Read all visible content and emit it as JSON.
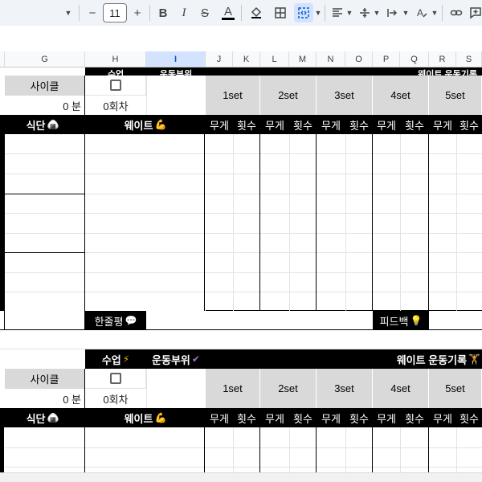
{
  "toolbar": {
    "font_size": "11",
    "minus": "−",
    "plus": "+",
    "bold": "B",
    "italic": "I",
    "strike": "S",
    "text_color": "A",
    "text_color_swatch": "#000000",
    "fill_icon": "paint-bucket-icon",
    "borders_icon": "borders-icon",
    "merge_icon": "merge-cells-icon",
    "align_icon": "align-left-icon",
    "valign_icon": "vertical-align-icon",
    "wrap_icon": "text-wrap-icon",
    "rotate_icon": "text-rotate-icon",
    "link_icon": "link-icon",
    "comment_icon": "add-comment-icon"
  },
  "columns": [
    "G",
    "H",
    "I",
    "J",
    "K",
    "L",
    "M",
    "N",
    "O",
    "P",
    "Q",
    "R",
    "S"
  ],
  "selected_column": "I",
  "block1": {
    "top_partial_h": "수업",
    "top_partial_i": "운동부위",
    "top_partial_right": "웨이트 운동기록",
    "cycle_label": "사이클",
    "minutes_value": "0 분",
    "session_value": "0회차",
    "diet_label": "식단",
    "weight_label": "웨이트",
    "sets": [
      "1set",
      "2set",
      "3set",
      "4set",
      "5set"
    ],
    "weight_col": "무게",
    "reps_col": "횟수",
    "review_label": "한줄평",
    "feedback_label": "피드백"
  },
  "block2": {
    "class_label": "수업",
    "body_part_label": "운동부위",
    "record_label": "웨이트 운동기록",
    "cycle_label": "사이클",
    "minutes_value": "0 분",
    "session_value": "0회차",
    "diet_label": "식단",
    "weight_label": "웨이트",
    "sets": [
      "1set",
      "2set",
      "3set",
      "4set",
      "5set"
    ],
    "weight_col": "무게",
    "reps_col": "횟수"
  },
  "emoji": {
    "lightning": "⚡",
    "check": "✔",
    "rice": "🍙",
    "muscle": "💪",
    "speech": "💬",
    "bulb": "💡",
    "dumbbell": "🏋"
  },
  "colors": {
    "header_black": "#000000",
    "header_gray": "#d9d9d9",
    "selection_blue": "#d3e3fd",
    "toolbar_bg": "#f0f4f9"
  }
}
